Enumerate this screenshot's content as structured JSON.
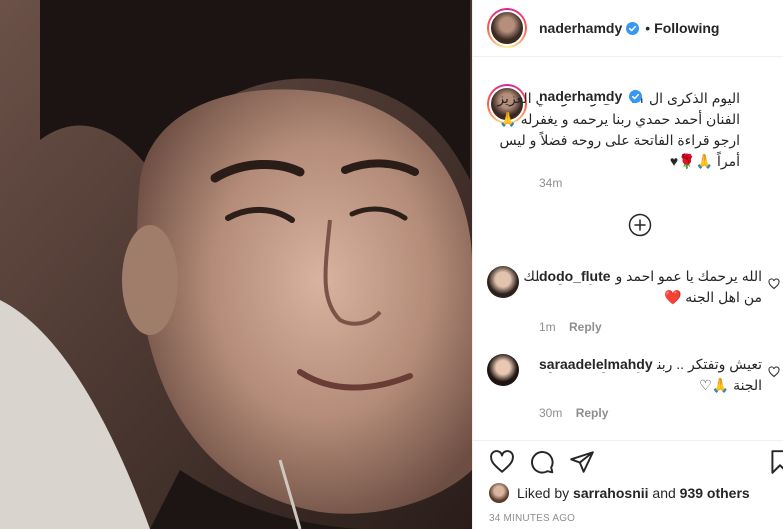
{
  "post": {
    "username": "naderhamdy",
    "follow_status": "Following",
    "separator": "•"
  },
  "caption": {
    "username": "naderhamdy",
    "text": "اليوم الذكرى ال ٢١ على وفاة والدي العزيز الفنان أحمد حمدي ربنا يرحمه و يغفرله 🙏 ارجو قراءة الفاتحة على روحه فضلاً و ليس أمراً 🙏🌹♥",
    "time": "34m"
  },
  "comments": [
    {
      "username": "dodo_flute",
      "text": "الله يرحمك يا عمو احمد ويغفر لك ويجعلك من اهل الجنه ❤️",
      "time": "1m",
      "reply_label": "Reply"
    },
    {
      "username": "saraadelelmahdy",
      "text": "تعيش وتفتكر .. ربنا يرحمه ويجعل مثواه الجنة 🙏♡",
      "time": "30m",
      "reply_label": "Reply"
    }
  ],
  "likes": {
    "prefix": "Liked by",
    "user": "sarrahosnii",
    "middle": "and",
    "others": "939 others"
  },
  "timestamp": "34 MINUTES AGO",
  "icons": {
    "verified": "verified-badge-icon",
    "load_more": "plus-circle-icon",
    "like": "heart-icon",
    "comment": "comment-bubble-icon",
    "share": "paper-plane-icon",
    "save": "bookmark-icon"
  },
  "colors": {
    "verified_blue": "#3897f0",
    "muted_text": "#8e8e8e",
    "border": "#efefef"
  }
}
